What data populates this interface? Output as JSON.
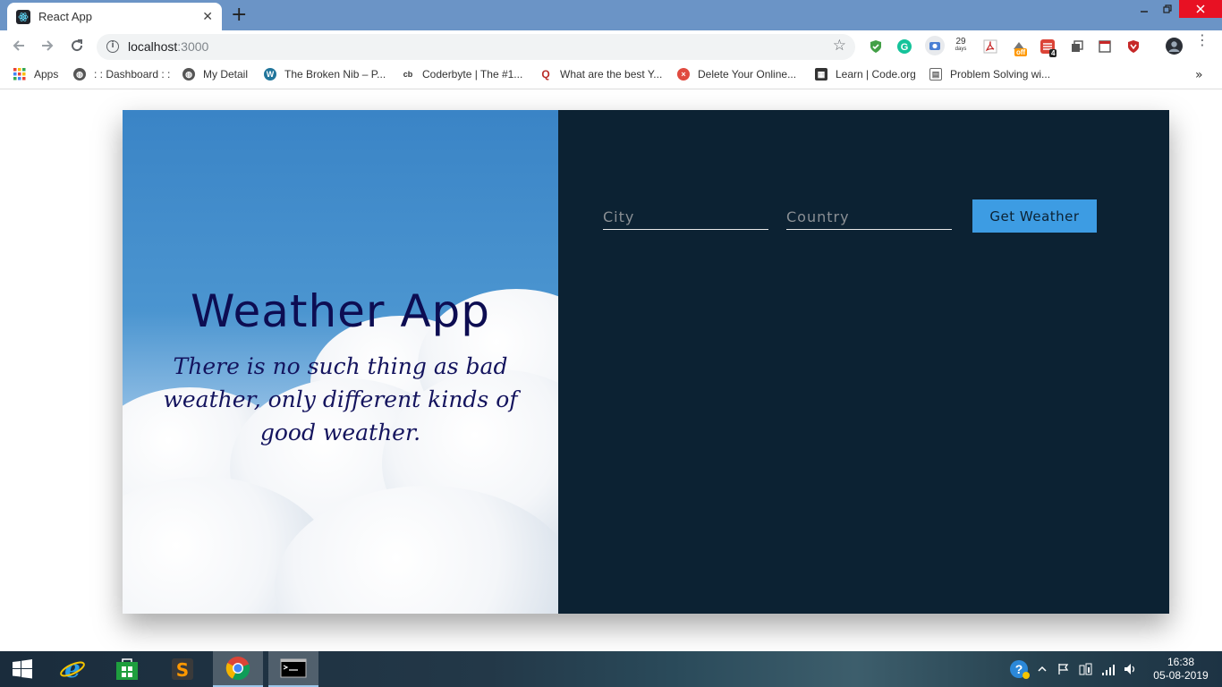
{
  "browser": {
    "tab_title": "React App",
    "tab_close": "✕",
    "new_tab": "+",
    "url_host": "localhost",
    "url_port": ":3000",
    "extensions": {
      "days_count": "29",
      "days_label": "days",
      "offer_badge": "off",
      "count_badge": "4"
    }
  },
  "bookmarks": [
    {
      "label": "Apps",
      "icon": "apps-grid-icon",
      "color": "#ea4335"
    },
    {
      "label": ": : Dashboard : :",
      "icon": "globe-icon",
      "color": "#555555"
    },
    {
      "label": "My Detail",
      "icon": "globe-icon",
      "color": "#555555"
    },
    {
      "label": "The Broken Nib – P...",
      "icon": "wordpress-icon",
      "color": "#21759b"
    },
    {
      "label": "Coderbyte | The #1...",
      "icon": "coderbyte-icon",
      "color": "#333333"
    },
    {
      "label": "What are the best Y...",
      "icon": "quora-icon",
      "color": "#b92b27"
    },
    {
      "label": "Delete Your Online...",
      "icon": "red-face-icon",
      "color": "#e04a3f"
    },
    {
      "label": "Learn | Code.org",
      "icon": "codeorg-icon",
      "color": "#333333"
    },
    {
      "label": "Problem Solving wi...",
      "icon": "page-icon",
      "color": "#666666"
    }
  ],
  "app": {
    "title": "Weather App",
    "quote": "There is no such thing as bad weather, only different kinds of good weather.",
    "city_placeholder": "City",
    "country_placeholder": "Country",
    "button_label": "Get Weather"
  },
  "colors": {
    "panel_bg": "#0c2233",
    "button_bg": "#3d9ce3",
    "title_color": "#0d0d52"
  },
  "taskbar": {
    "time": "16:38",
    "date": "05-08-2019"
  }
}
